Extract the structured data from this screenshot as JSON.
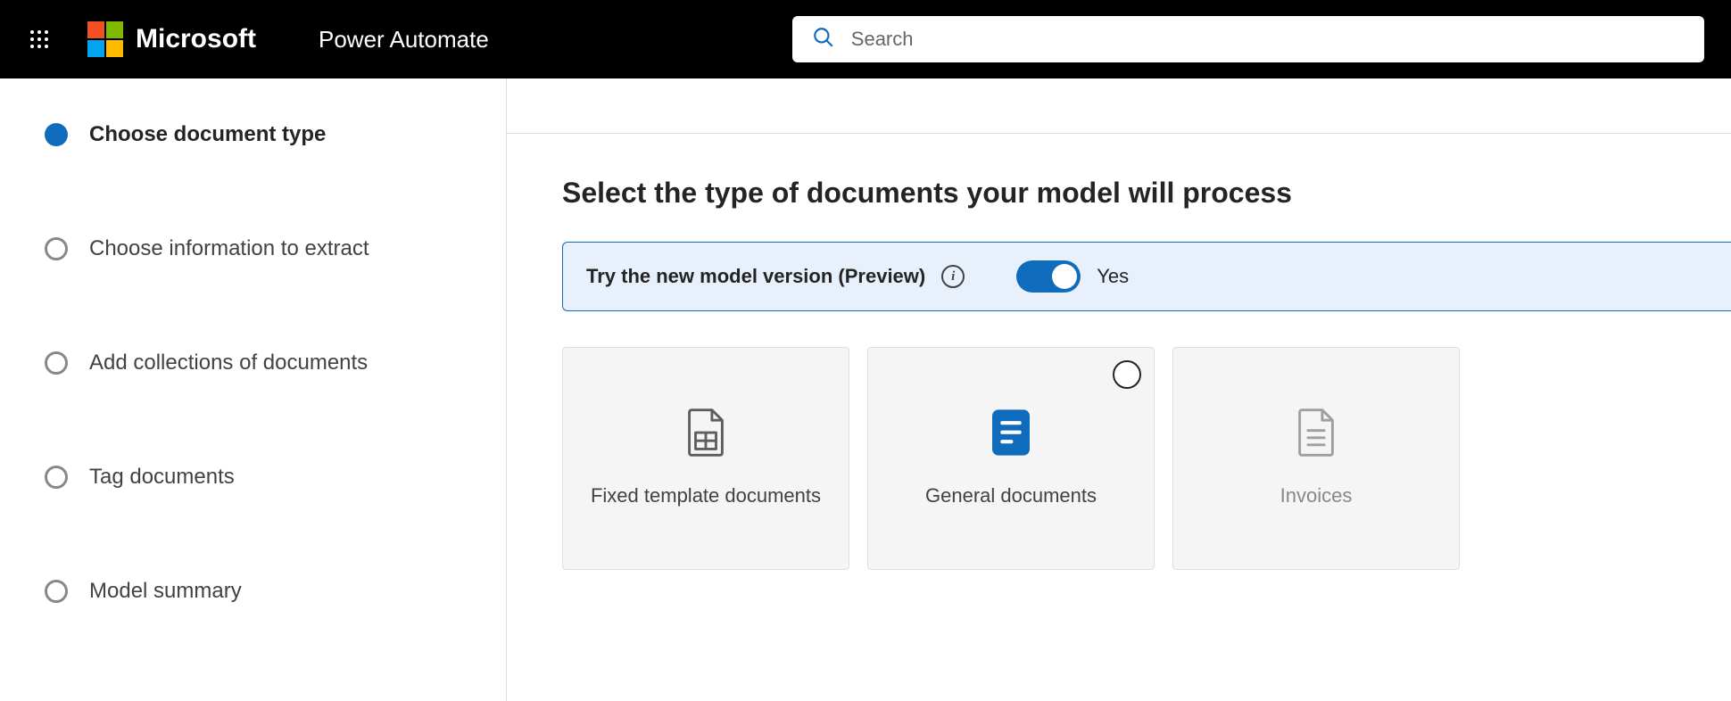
{
  "header": {
    "brand": "Microsoft",
    "app_name": "Power Automate",
    "search_placeholder": "Search"
  },
  "sidebar": {
    "steps": [
      {
        "label": "Choose document type",
        "active": true
      },
      {
        "label": "Choose information to extract",
        "active": false
      },
      {
        "label": "Add collections of documents",
        "active": false
      },
      {
        "label": "Tag documents",
        "active": false
      },
      {
        "label": "Model summary",
        "active": false
      }
    ]
  },
  "main": {
    "title": "Select the type of documents your model will process",
    "banner": {
      "text": "Try the new model version (Preview)",
      "toggle_on": true,
      "toggle_label": "Yes"
    },
    "cards": [
      {
        "label": "Fixed template documents",
        "kind": "template",
        "radio": false,
        "disabled": false
      },
      {
        "label": "General documents",
        "kind": "general",
        "radio": true,
        "disabled": false
      },
      {
        "label": "Invoices",
        "kind": "invoice",
        "radio": false,
        "disabled": true
      }
    ]
  }
}
